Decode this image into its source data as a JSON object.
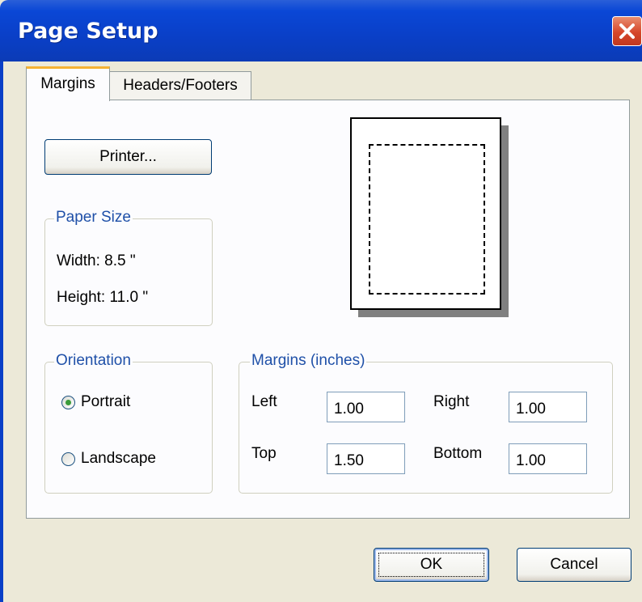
{
  "window": {
    "title": "Page Setup"
  },
  "tabs": [
    {
      "label": "Margins",
      "active": true
    },
    {
      "label": "Headers/Footers",
      "active": false
    }
  ],
  "printer_button": {
    "label": "Printer..."
  },
  "paper_size": {
    "legend": "Paper Size",
    "width_text": "Width: 8.5 \"",
    "height_text": "Height: 11.0 \""
  },
  "orientation": {
    "legend": "Orientation",
    "options": [
      {
        "label": "Portrait",
        "selected": true
      },
      {
        "label": "Landscape",
        "selected": false
      }
    ]
  },
  "margins": {
    "legend": "Margins (inches)",
    "left": {
      "label": "Left",
      "value": "1.00"
    },
    "right": {
      "label": "Right",
      "value": "1.00"
    },
    "top": {
      "label": "Top",
      "value": "1.50"
    },
    "bottom": {
      "label": "Bottom",
      "value": "1.00"
    }
  },
  "buttons": {
    "ok": "OK",
    "cancel": "Cancel"
  },
  "icons": {
    "close": "close-icon"
  },
  "colors": {
    "titlebar": "#0A3FC7",
    "close": "#D5462A",
    "tab_accent": "#F5B233",
    "legend_text": "#1F50A8",
    "radio_dot": "#3A9B3A"
  }
}
